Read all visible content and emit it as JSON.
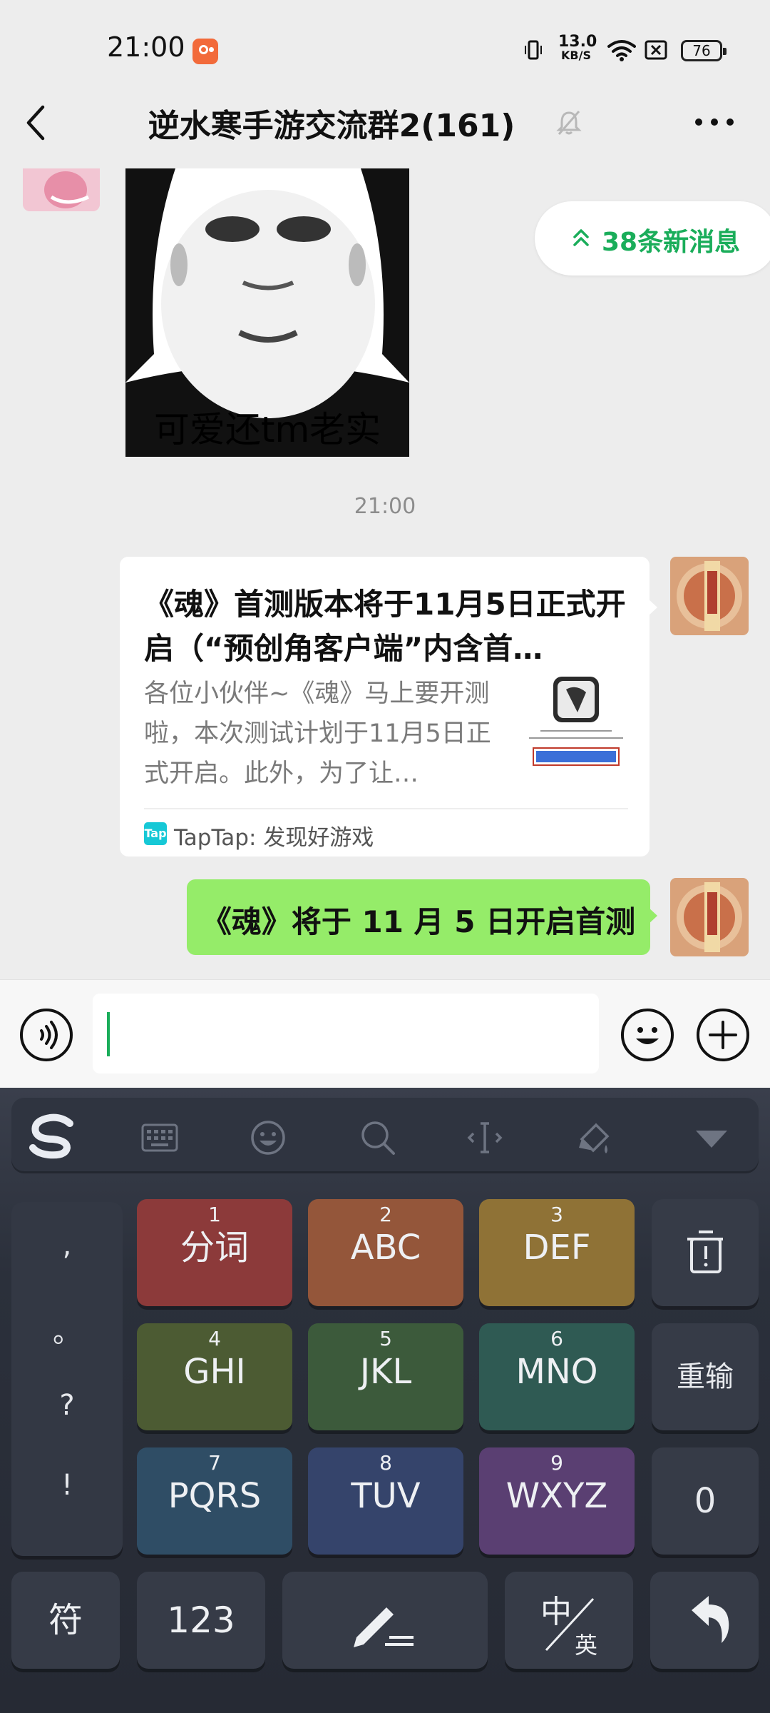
{
  "status_bar": {
    "time": "21:00",
    "net_speed_value": "13.0",
    "net_speed_unit": "KB/S",
    "battery": "76"
  },
  "header": {
    "title": "逆水寒手游交流群2(161)"
  },
  "chat": {
    "meme_caption": "可爱还tm老实",
    "new_messages": "38条新消息",
    "timestamp": "21:00",
    "link_card": {
      "title": "《魂》首测版本将于11月5日正式开启（“预创角客户端”内含首…",
      "description": "各位小伙伴~《魂》马上要开测啦，本次测试计划于11月5日正式开启。此外，为了让…",
      "source_icon": "Tap",
      "source": "TapTap: 发现好游戏"
    },
    "outgoing_text": "《魂》将于 11 月 5 日开启首测"
  },
  "input": {
    "placeholder": ""
  },
  "keyboard": {
    "punctuation": [
      ",",
      "。",
      "?",
      "!"
    ],
    "keys": [
      {
        "num": "1",
        "label": "分词",
        "color": "#8c3a3a"
      },
      {
        "num": "2",
        "label": "ABC",
        "color": "#94563a"
      },
      {
        "num": "3",
        "label": "DEF",
        "color": "#8f7236"
      },
      {
        "num": "4",
        "label": "GHI",
        "color": "#4c5b33"
      },
      {
        "num": "5",
        "label": "JKL",
        "color": "#3c5a3b"
      },
      {
        "num": "6",
        "label": "MNO",
        "color": "#2f5a53"
      },
      {
        "num": "7",
        "label": "PQRS",
        "color": "#2f4d65"
      },
      {
        "num": "8",
        "label": "TUV",
        "color": "#35446b"
      },
      {
        "num": "9",
        "label": "WXYZ",
        "color": "#5a3f72"
      }
    ],
    "reenter": "重输",
    "zero": "0",
    "symbols": "符",
    "numbers": "123",
    "lang_top": "中",
    "lang_bottom": "英"
  }
}
